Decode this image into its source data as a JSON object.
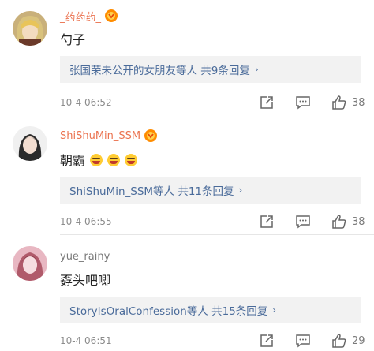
{
  "comments": [
    {
      "username": "_药药药_",
      "text": "勺子",
      "reply_summary": "张国荣未公开的女朋友等人  共9条回复",
      "timestamp": "10-4 06:52",
      "likes": "38"
    },
    {
      "username": "ShiShuMin_SSM",
      "text": "朝霸",
      "reply_summary": "ShiShuMin_SSM等人  共11条回复",
      "timestamp": "10-4 06:55",
      "likes": "38"
    },
    {
      "username": "yue_rainy",
      "text": "孬头吧唧",
      "reply_summary": "StoryIsOralConfession等人  共15条回复",
      "timestamp": "10-4 06:51",
      "likes": "29"
    }
  ],
  "colors": {
    "username_orange": "#eb7350",
    "reply_link": "#4a6b9a",
    "reply_bg": "#f2f2f2"
  },
  "icons": [
    "vip-icon",
    "share-icon",
    "comment-icon",
    "like-icon",
    "chevron-right-icon"
  ]
}
